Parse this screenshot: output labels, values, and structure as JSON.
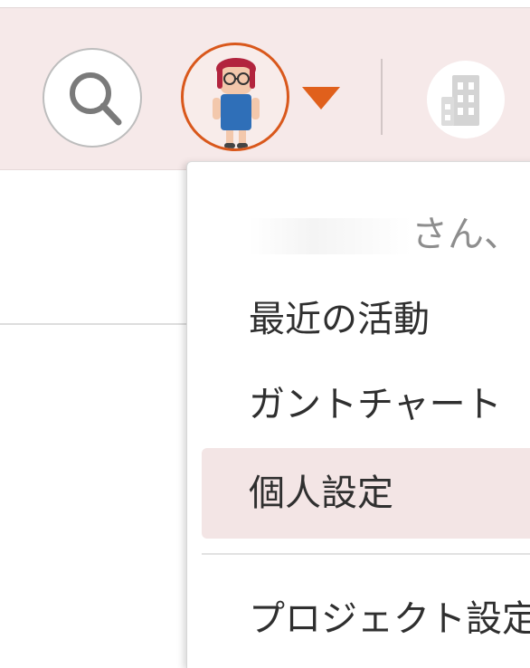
{
  "header": {
    "search_icon": "search-icon",
    "avatar_icon": "user-avatar",
    "menu_caret_icon": "caret-down-icon",
    "org_icon": "building-icon",
    "colors": {
      "bar": "#f6e9e9",
      "accent": "#e0601c"
    }
  },
  "user_menu": {
    "user_name_suffix": "さん、",
    "items": [
      {
        "label": "最近の活動"
      },
      {
        "label": "ガントチャート"
      },
      {
        "label": "個人設定",
        "highlighted": true
      },
      {
        "label": "プロジェクト設定"
      }
    ]
  }
}
